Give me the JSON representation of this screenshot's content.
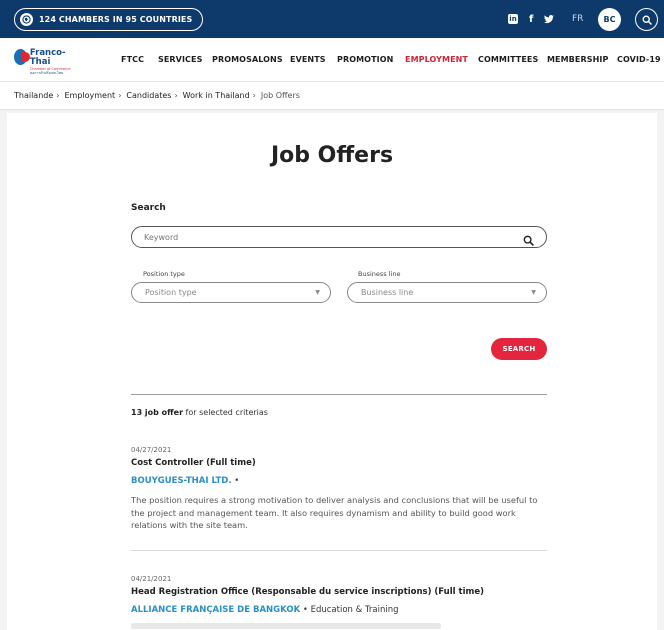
{
  "topbar": {
    "chambers": "124 CHAMBERS IN 95 COUNTRIES",
    "lang": "FR",
    "user_initials": "BC",
    "social": [
      "linkedin-icon",
      "facebook-icon",
      "twitter-icon"
    ]
  },
  "logo": {
    "name": "Franco-Thai",
    "sub": "Chamber of Commerce",
    "thai": "หอการค้าฝรั่งเศส-ไทย"
  },
  "nav": {
    "items": [
      "FTCC",
      "SERVICES",
      "PROMOSALONS",
      "EVENTS",
      "PROMOTION",
      "EMPLOYMENT",
      "COMMITTEES",
      "MEMBERSHIP",
      "COVID-19"
    ],
    "active": "EMPLOYMENT"
  },
  "breadcrumb": [
    "Thailande",
    "Employment",
    "Candidates",
    "Work in Thailand",
    "Job Offers"
  ],
  "page": {
    "title": "Job Offers"
  },
  "search": {
    "label": "Search",
    "keyword_placeholder": "Keyword",
    "position_label": "Position type",
    "position_value": "Position type",
    "business_label": "Business line",
    "business_value": "Business line",
    "button": "SEARCH"
  },
  "results": {
    "count": "13 job offer",
    "suffix": " for selected criterias"
  },
  "jobs": [
    {
      "date": "04/27/2021",
      "title": "Cost Controller (Full time)",
      "company": "BOUYGUES-THAI LTD.",
      "industry": "",
      "desc": "The position requires a strong motivation to deliver analysis and conclusions that will be useful to the project and management team. It also requires dynamism and ability to build good work relations with the site team."
    },
    {
      "date": "04/21/2021",
      "title": "Head Registration Office (Responsable du service inscriptions) (Full time)",
      "company": "ALLIANCE FRANÇAISE DE BANGKOK",
      "industry": "Education & Training",
      "desc": ""
    }
  ],
  "colors": {
    "topbar": "#0e3a6b",
    "accent_red": "#e3253d",
    "company_blue": "#2a8fc7"
  }
}
